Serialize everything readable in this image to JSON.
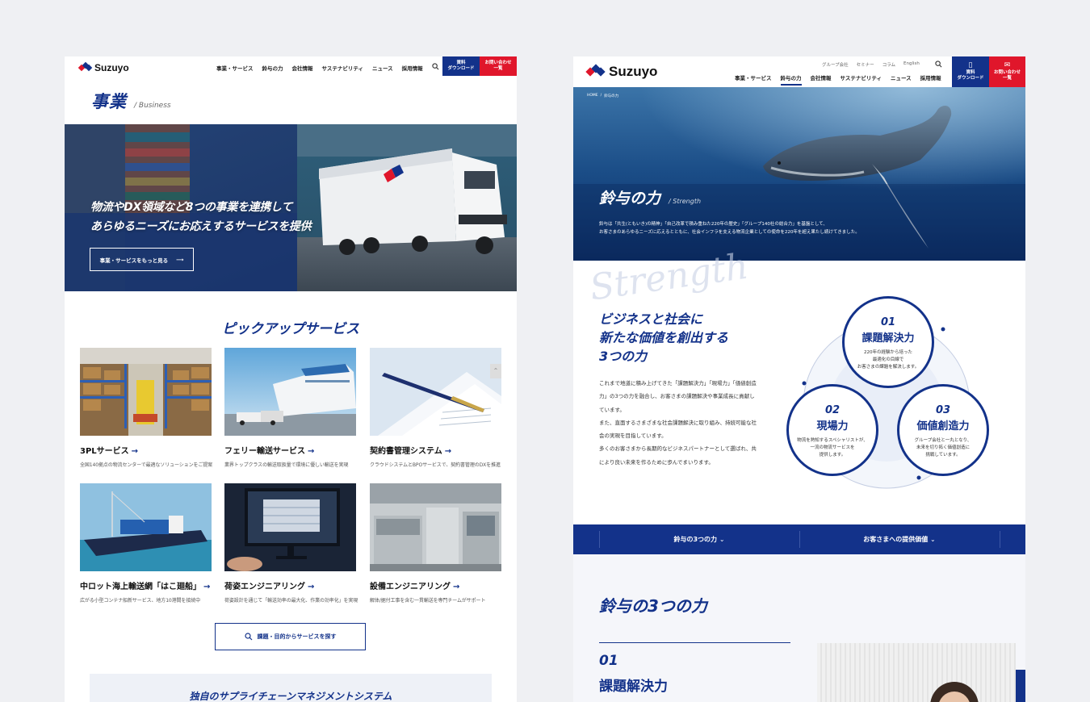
{
  "left": {
    "logo": "Suzuyo",
    "nav": [
      "事業・サービス",
      "鈴与の力",
      "会社情報",
      "サステナビリティ",
      "ニュース",
      "採用情報"
    ],
    "download_btn": [
      "資料",
      "ダウンロード"
    ],
    "contact_btn": [
      "お問い合わせ",
      "一覧"
    ],
    "page_title": "事業",
    "page_title_en": "/ Business",
    "hero_line1": "物流やDX領域など8つの事業を連携して",
    "hero_line2": "あらゆるニーズにお応えするサービスを提供",
    "hero_btn": "事業・サービスをもっと見る",
    "pickup_title": "ピックアップサービス",
    "services": [
      {
        "title": "3PLサービス",
        "desc": "全国140拠点の物流センターで最適なソリューションをご提案"
      },
      {
        "title": "フェリー輸送サービス",
        "desc": "業界トップクラスの輸送取扱量で環境に優しい輸送を実現"
      },
      {
        "title": "契約書管理システム",
        "desc": "クラウドシステムとBPOサービスで、契約書管理のDXを推進"
      },
      {
        "title": "中ロット海上輸送網「はこ廻船」",
        "desc": "広がる小型コンテナ船新サービス、地方10港間を接続中"
      },
      {
        "title": "荷姿エンジニアリング",
        "desc": "荷姿設計を通じて「輸送効率の最大化、作業の効率化」を実現"
      },
      {
        "title": "設備エンジニアリング",
        "desc": "解体/据付工事を含む一貫輸送を専門チームがサポート"
      }
    ],
    "search_btn": "課題・目的からサービスを探す",
    "scm_title": "独自のサプライチェーンマネジメントシステム"
  },
  "right": {
    "logo": "Suzuyo",
    "util_nav": [
      "グループ会社",
      "セミナー",
      "コラム",
      "English"
    ],
    "nav": [
      "事業・サービス",
      "鈴与の力",
      "会社情報",
      "サステナビリティ",
      "ニュース",
      "採用情報"
    ],
    "download_btn": [
      "資料",
      "ダウンロード"
    ],
    "contact_btn": [
      "お問い合わせ",
      "一覧"
    ],
    "breadcrumb": [
      "HOME",
      "/",
      "鈴与の力"
    ],
    "hero_title": "鈴与の力",
    "hero_title_en": "/ Strength",
    "hero_desc1": "鈴与は「共生(ともいき)の精神」「自己改革で積み重ねた220年の歴史」「グループ140社の総合力」を基盤として、",
    "hero_desc2": "お客さまのあらゆるニーズに応えるとともに、社会インフラを支える物流企業としての使命を220年を超え果たし続けてきました。",
    "script_word": "Strength",
    "heading": [
      "ビジネスと社会に",
      "新たな価値を創出する",
      "3つの力"
    ],
    "body": [
      "これまで地道に積み上げてきた「課題解決力」「現場力」「価値創造",
      "力」の3つの力を融合し、お客さまの課題解決や事業成長に貢献し",
      "ています。",
      "また、直面するさまざまな社会課題解決に取り組み、持続可能な社",
      "会の実現を目指しています。",
      "多くのお客さまから長期的なビジネスパートナーとして選ばれ、共",
      "により良い未来を作るために歩んでまいります。"
    ],
    "circles": [
      {
        "num": "01",
        "title": "課題解決力",
        "desc": [
          "220年の経験から培った",
          "最適化の目線で",
          "お客さまの課題を解決します。"
        ]
      },
      {
        "num": "02",
        "title": "現場力",
        "desc": [
          "物流を熟知するスペシャリストが、",
          "一流の物流サービスを",
          "提供します。"
        ]
      },
      {
        "num": "03",
        "title": "価値創造力",
        "desc": [
          "グループ会社と一丸となり、",
          "未来を切り拓く価値創造に",
          "挑戦しています。"
        ]
      }
    ],
    "tabs": [
      "鈴与の3つの力",
      "お客さまへの提供価値"
    ],
    "section_title": "鈴与の3つの力",
    "section_num": "01",
    "section_sub": "課題解決力"
  },
  "colors": {
    "navy": "#13328a",
    "red": "#e0162b",
    "bg": "#eff0f3"
  }
}
